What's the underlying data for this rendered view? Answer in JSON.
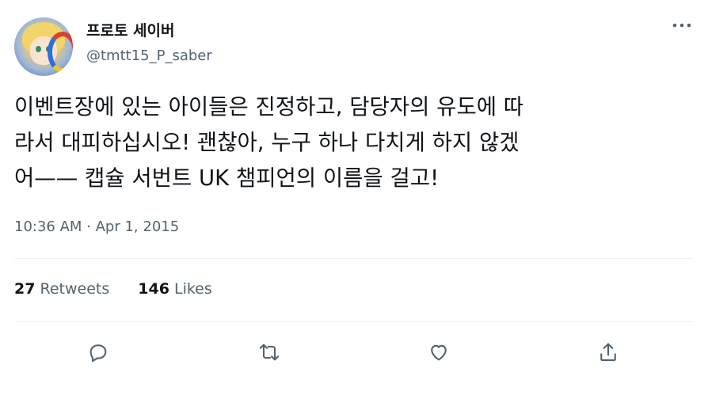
{
  "user": {
    "display_name": "프로토 세이버",
    "handle": "@tmtt15_P_saber"
  },
  "more_icon": "more-horizontal-icon",
  "tweet": {
    "lines": [
      "이벤트장에 있는 아이들은 진정하고, 담당자의 유도에 따",
      "라서 대피하십시오! 괜찮아, 누구 하나 다치게 하지 않겠",
      "어—— 캡슐 서번트 UK 챔피언의 이름을 걸고!"
    ],
    "timestamp": "10:36 AM · Apr 1, 2015"
  },
  "stats": {
    "retweets_count": "27",
    "retweets_label": "Retweets",
    "likes_count": "146",
    "likes_label": "Likes"
  },
  "actions": {
    "reply_icon": "reply-icon",
    "retweet_icon": "retweet-icon",
    "like_icon": "heart-icon",
    "share_icon": "share-icon"
  },
  "colors": {
    "text_primary": "#0f1419",
    "text_secondary": "#536471",
    "divider": "#eff3f4"
  }
}
